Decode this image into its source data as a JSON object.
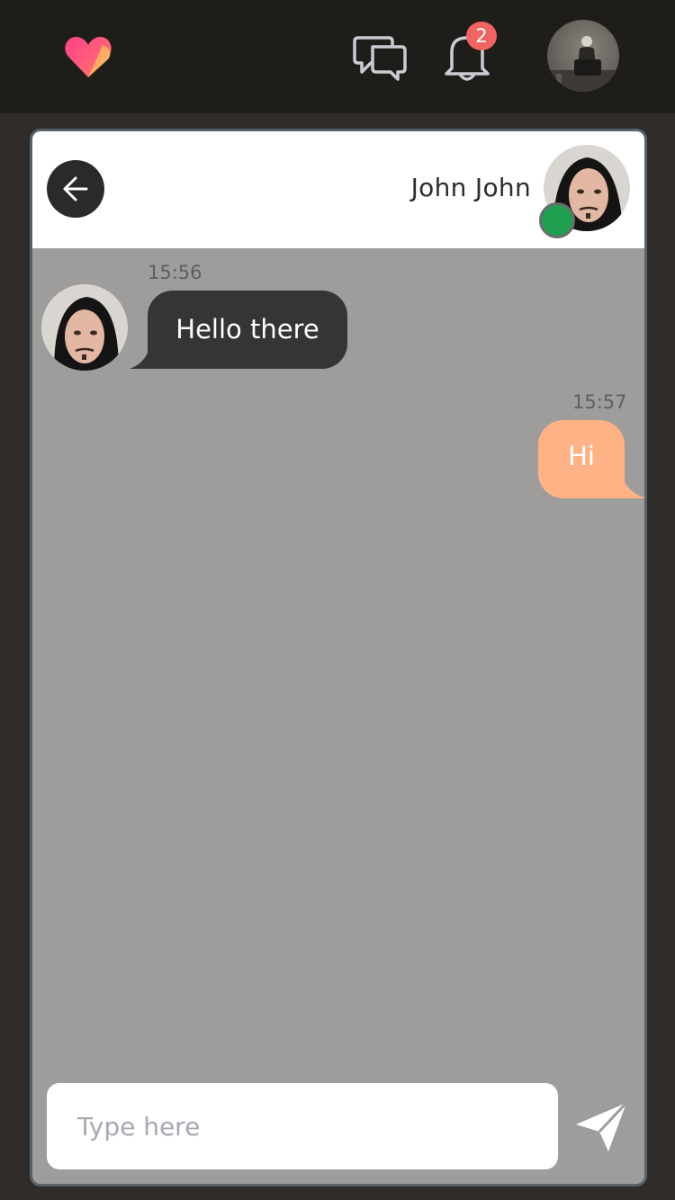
{
  "topbar": {
    "notification_count": "2",
    "icons": [
      "heart-logo-icon",
      "chat-bubbles-icon",
      "bell-icon",
      "user-avatar"
    ]
  },
  "chat": {
    "contact_name": "John John",
    "contact_status": "online",
    "messages": [
      {
        "direction": "incoming",
        "time": "15:56",
        "text": "Hello there"
      },
      {
        "direction": "outgoing",
        "time": "15:57",
        "text": "Hi"
      }
    ]
  },
  "composer": {
    "placeholder": "Type here",
    "value": ""
  },
  "colors": {
    "topbar_bg": "#1f1d1a",
    "page_bg": "#302c29",
    "chat_bg": "#9e9d9b",
    "incoming_bubble": "#373533",
    "outgoing_bubble": "#ffb285",
    "online": "#1fa050",
    "badge": "#f06464"
  }
}
